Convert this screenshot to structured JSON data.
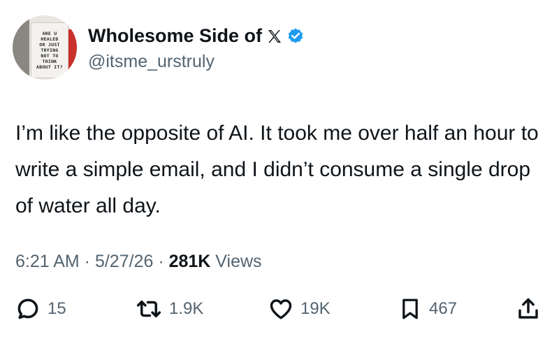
{
  "author": {
    "display_name": "Wholesome Side of",
    "handle": "@itsme_urstruly",
    "avatar_sign_lines": [
      "ARE U",
      "HEALED",
      "OR JUST",
      "TRYING",
      "NOT TO",
      "THINK",
      "ABOUT IT?"
    ],
    "verified_color": "#1d9bf0"
  },
  "tweet": {
    "text": "I’m like the opposite of AI. It took me over half an hour to write a simple email, and I didn’t consume a single drop of water all day.",
    "time": "6:21 AM",
    "sep1": " · ",
    "date": "5/27/26",
    "sep2": " · ",
    "views_count": "281K",
    "views_label": " Views"
  },
  "actions": {
    "replies": "15",
    "reposts": "1.9K",
    "likes": "19K",
    "bookmarks": "467"
  },
  "icons": [
    "reply-icon",
    "repost-icon",
    "like-icon",
    "bookmark-icon",
    "share-icon",
    "x-logo-icon",
    "verified-badge-icon"
  ]
}
